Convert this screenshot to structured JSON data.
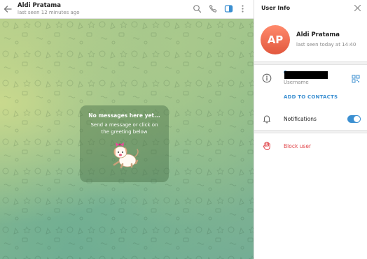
{
  "chat": {
    "title": "Aldi Pratama",
    "subtitle": "last seen 12 minutes ago",
    "empty_title": "No messages here yet...",
    "empty_hint": "Send a message or click on the greeting below"
  },
  "header_icons": [
    "back-arrow-icon",
    "search-icon",
    "phone-icon",
    "sidebar-toggle-icon",
    "more-vertical-icon"
  ],
  "user_info": {
    "panel_title": "User Info",
    "avatar_initials": "AP",
    "avatar_color": "#f2684f",
    "name": "Aldi Pratama",
    "status": "last seen today at 14:40",
    "username_label": "Username",
    "add_to_contacts": "ADD TO CONTACTS",
    "notifications_label": "Notifications",
    "notifications_enabled": true,
    "block_user": "Block user"
  },
  "colors": {
    "accent": "#3b8fd1",
    "danger": "#e0454a"
  }
}
